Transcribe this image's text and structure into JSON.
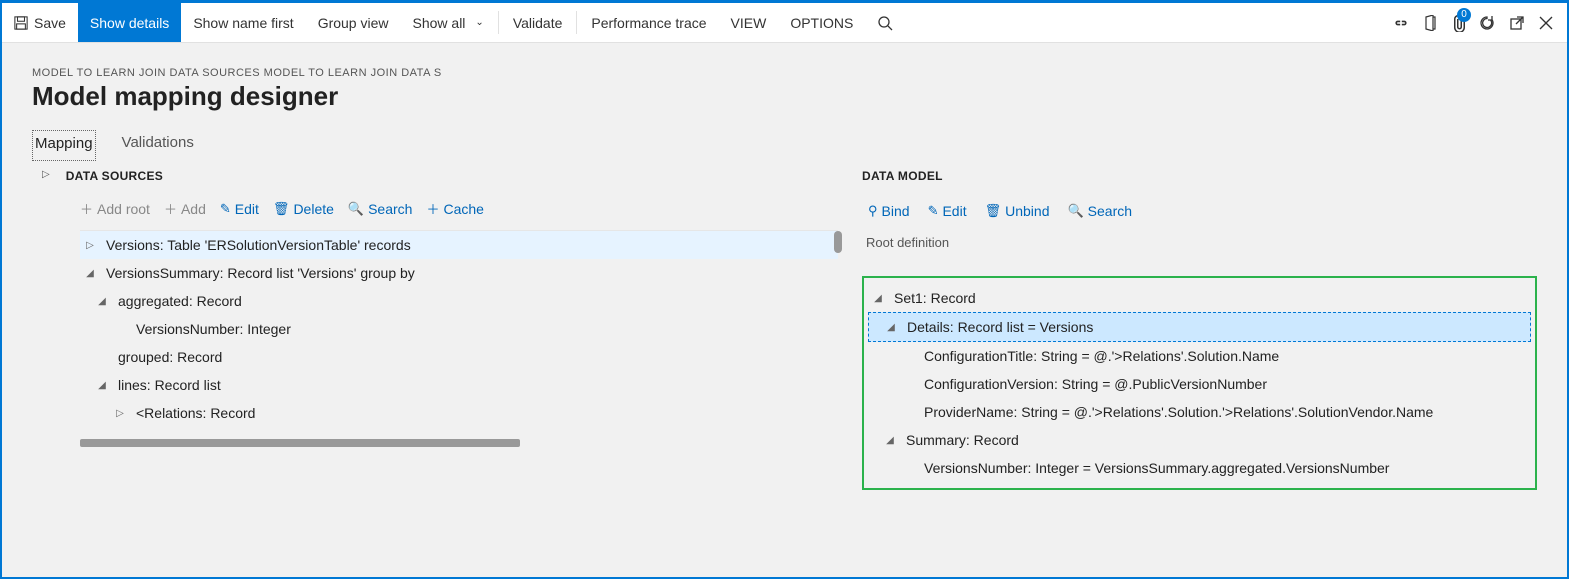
{
  "toolbar": {
    "save": "Save",
    "show_details": "Show details",
    "show_name_first": "Show name first",
    "group_view": "Group view",
    "show_all": "Show all",
    "validate": "Validate",
    "performance_trace": "Performance trace",
    "view": "VIEW",
    "options": "OPTIONS",
    "badge_count": "0"
  },
  "breadcrumb": "MODEL TO LEARN JOIN DATA SOURCES MODEL TO LEARN JOIN DATA S",
  "page_title": "Model mapping designer",
  "tabs": {
    "mapping": "Mapping",
    "validations": "Validations"
  },
  "data_sources": {
    "label": "DATA SOURCES",
    "actions": {
      "add_root": "Add root",
      "add": "Add",
      "edit": "Edit",
      "delete": "Delete",
      "search": "Search",
      "cache": "Cache"
    },
    "tree": [
      {
        "id": "versions",
        "caret": "right",
        "indent": 0,
        "highlight": true,
        "text": "Versions: Table 'ERSolutionVersionTable' records"
      },
      {
        "id": "versions-summary",
        "caret": "down",
        "indent": 0,
        "text": "VersionsSummary: Record list 'Versions' group by"
      },
      {
        "id": "aggregated",
        "caret": "down",
        "indent": 1,
        "text": "aggregated: Record"
      },
      {
        "id": "versions-number",
        "caret": "leaf",
        "indent": 2,
        "text": "VersionsNumber: Integer"
      },
      {
        "id": "grouped",
        "caret": "leaf",
        "indent": 1,
        "text": "grouped: Record"
      },
      {
        "id": "lines",
        "caret": "down",
        "indent": 1,
        "text": "lines: Record list"
      },
      {
        "id": "relations",
        "caret": "right",
        "indent": 2,
        "text": "<Relations: Record"
      }
    ]
  },
  "data_model": {
    "label": "DATA MODEL",
    "actions": {
      "bind": "Bind",
      "edit": "Edit",
      "unbind": "Unbind",
      "search": "Search"
    },
    "root_definition": "Root definition",
    "tree": [
      {
        "id": "set1",
        "caret": "down",
        "indent": 0,
        "text": "Set1: Record"
      },
      {
        "id": "details",
        "caret": "down",
        "indent": 1,
        "selected": true,
        "text": "Details: Record list = Versions"
      },
      {
        "id": "config-title",
        "caret": "leaf",
        "indent": 2,
        "text": "ConfigurationTitle: String = @.'>Relations'.Solution.Name"
      },
      {
        "id": "config-version",
        "caret": "leaf",
        "indent": 2,
        "text": "ConfigurationVersion: String = @.PublicVersionNumber"
      },
      {
        "id": "provider-name",
        "caret": "leaf",
        "indent": 2,
        "text": "ProviderName: String = @.'>Relations'.Solution.'>Relations'.SolutionVendor.Name"
      },
      {
        "id": "summary",
        "caret": "down",
        "indent": 1,
        "text": "Summary: Record"
      },
      {
        "id": "versions-number-dm",
        "caret": "leaf",
        "indent": 2,
        "text": "VersionsNumber: Integer = VersionsSummary.aggregated.VersionsNumber"
      }
    ]
  }
}
